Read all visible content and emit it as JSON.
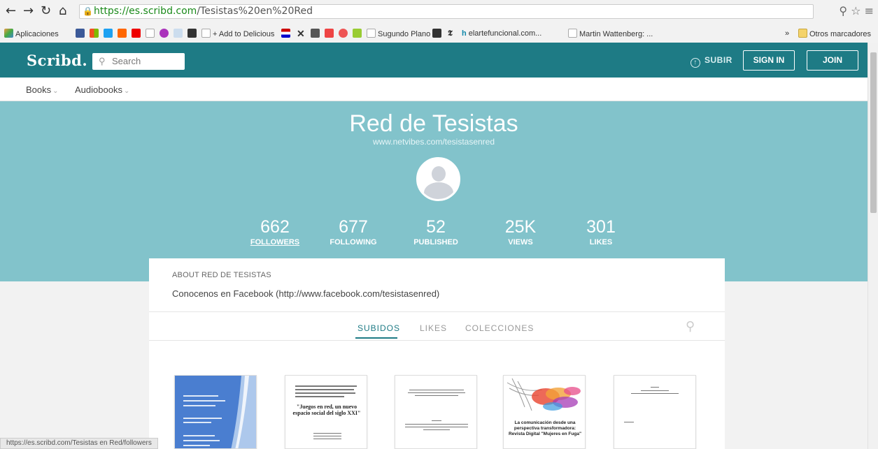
{
  "browser": {
    "url_host": "https://es.scribd.com",
    "url_path": "/Tesistas%20en%20Red",
    "bookmarks_apps": "Aplicaciones",
    "bookmarks_delicious": "+ Add to Delicious",
    "bookmarks_plano": "Sugundo Plano",
    "bookmarks_elarte": "elartefuncional.com...",
    "bookmarks_martin": "Martin Wattenberg: ...",
    "bookmarks_more": "»",
    "bookmarks_otros": "Otros marcadores"
  },
  "header": {
    "logo": "Scribd.",
    "search_placeholder": "Search",
    "upload_label": "SUBIR",
    "sign_in": "SIGN IN",
    "join": "JOIN"
  },
  "subnav": {
    "books": "Books",
    "audiobooks": "Audiobooks"
  },
  "profile": {
    "name": "Red de Tesistas",
    "url": "www.netvibes.com/tesistasenred",
    "stats": [
      {
        "value": "662",
        "label": "FOLLOWERS"
      },
      {
        "value": "677",
        "label": "FOLLOWING"
      },
      {
        "value": "52",
        "label": "PUBLISHED"
      },
      {
        "value": "25K",
        "label": "VIEWS"
      },
      {
        "value": "301",
        "label": "LIKES"
      }
    ]
  },
  "about": {
    "title": "ABOUT RED DE TESISTAS",
    "text": "Conocenos en Facebook (http://www.facebook.com/tesistasenred)"
  },
  "tabs": [
    "SUBIDOS",
    "LIKES",
    "COLECCIONES"
  ],
  "docs": [
    {
      "title": ""
    },
    {
      "title": "\"Juegos en red, un nuevo espacio social del siglo XXI\""
    },
    {
      "title": ""
    },
    {
      "title": "La comunicación desde una perspectiva transformadora: Revista Digital \"Mujeres en Fuga\""
    },
    {
      "title": ""
    }
  ],
  "status_url": "https://es.scribd.com/Tesistas en Red/followers",
  "colors": {
    "header": "#1e7b85",
    "hero": "#82c3cb",
    "accent": "#1e7b85"
  }
}
